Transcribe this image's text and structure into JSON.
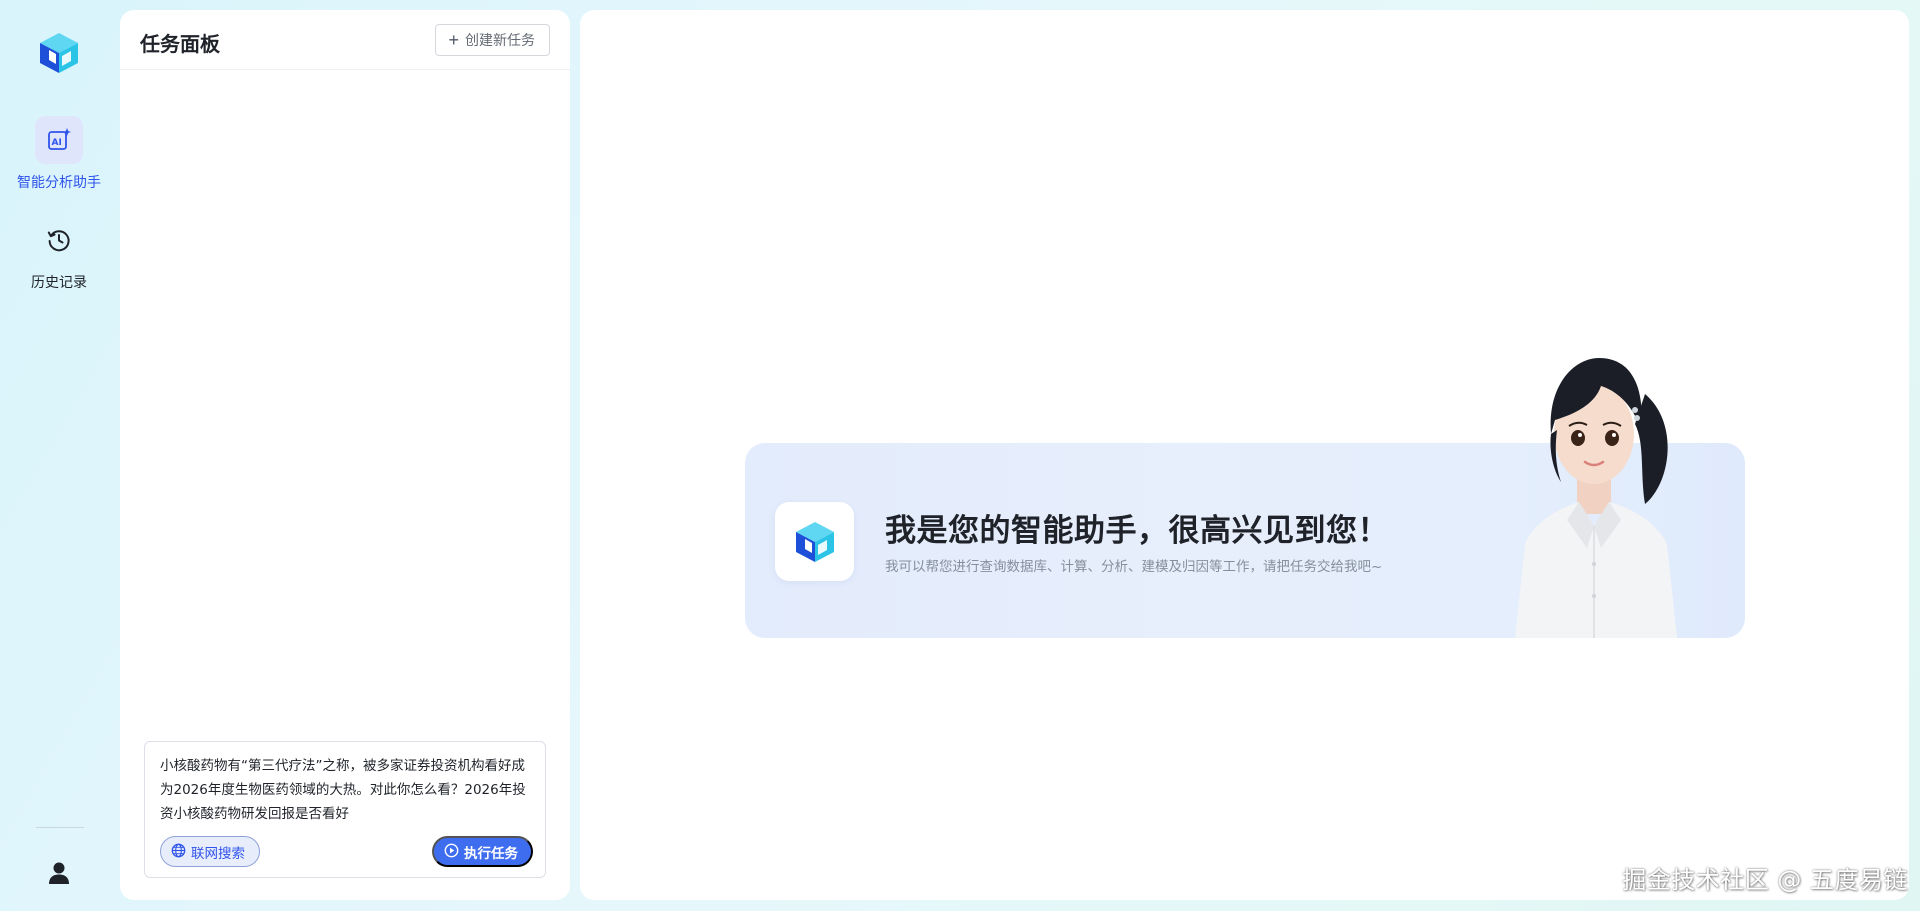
{
  "nav": {
    "items": [
      {
        "label": "智能分析助手",
        "icon": "ai-sparkle-icon",
        "active": true
      },
      {
        "label": "历史记录",
        "icon": "history-clock-icon",
        "active": false
      }
    ],
    "user_icon": "user-icon",
    "logo_icon": "cube-logo-icon"
  },
  "task_panel": {
    "title": "任务面板",
    "create_button_label": "创建新任务",
    "composer": {
      "text": "小核酸药物有“第三代疗法”之称，被多家证券投资机构看好成为2026年度生物医药领域的大热。对此你怎么看？2026年投资小核酸药物研发回报是否看好",
      "web_search_label": "联网搜索",
      "run_label": "执行任务"
    }
  },
  "main": {
    "welcome_title": "我是您的智能助手，很高兴见到您！",
    "welcome_subtitle": "我可以帮您进行查询数据库、计算、分析、建模及归因等工作，请把任务交给我吧~"
  },
  "watermark": "掘金技术社区 @ 五度易链",
  "colors": {
    "accent": "#3e6df0",
    "active_nav": "#2f54eb",
    "logo_blue": "#1d4fd8",
    "logo_cyan": "#2bc4e6"
  }
}
